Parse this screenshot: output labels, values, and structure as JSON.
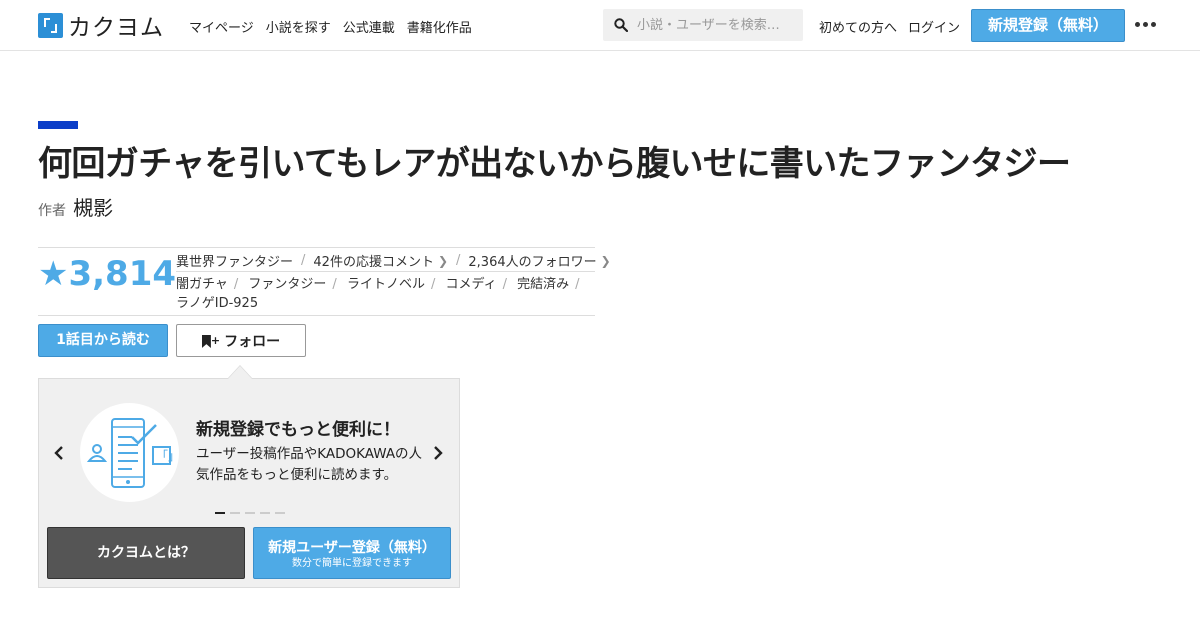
{
  "header": {
    "logo_text": "カクヨム",
    "nav": [
      "マイページ",
      "小説を探す",
      "公式連載",
      "書籍化作品"
    ],
    "search_placeholder": "小説・ユーザーを検索…",
    "first_time": "初めての方へ",
    "login": "ログイン",
    "signup": "新規登録（無料）"
  },
  "work": {
    "title": "何回ガチャを引いてもレアが出ないから腹いせに書いたファンタジー",
    "author_label": "作者",
    "author_name": "槻影",
    "rating": "3,814",
    "genre": "異世界ファンタジー",
    "cheer_comments": "42件の応援コメント",
    "followers": "2,364人のフォロワー",
    "tags": [
      "闇ガチャ",
      "ファンタジー",
      "ライトノベル",
      "コメディ",
      "完結済み",
      "ラノゲID-925"
    ]
  },
  "actions": {
    "read_first": "1話目から読む",
    "follow": "フォロー"
  },
  "promo": {
    "title": "新規登録でもっと便利に！",
    "desc": "ユーザー投稿作品やKADOKAWAの人気作品をもっと便利に読めます。",
    "slides": 5,
    "active_slide": 1,
    "about_btn": "カクヨムとは？",
    "register_btn": "新規ユーザー登録（無料）",
    "register_sub": "数分で簡単に登録できます"
  },
  "colors": {
    "accent": "#4eaae6",
    "title_bar": "#0b3ec8",
    "dark_button": "#555555"
  }
}
